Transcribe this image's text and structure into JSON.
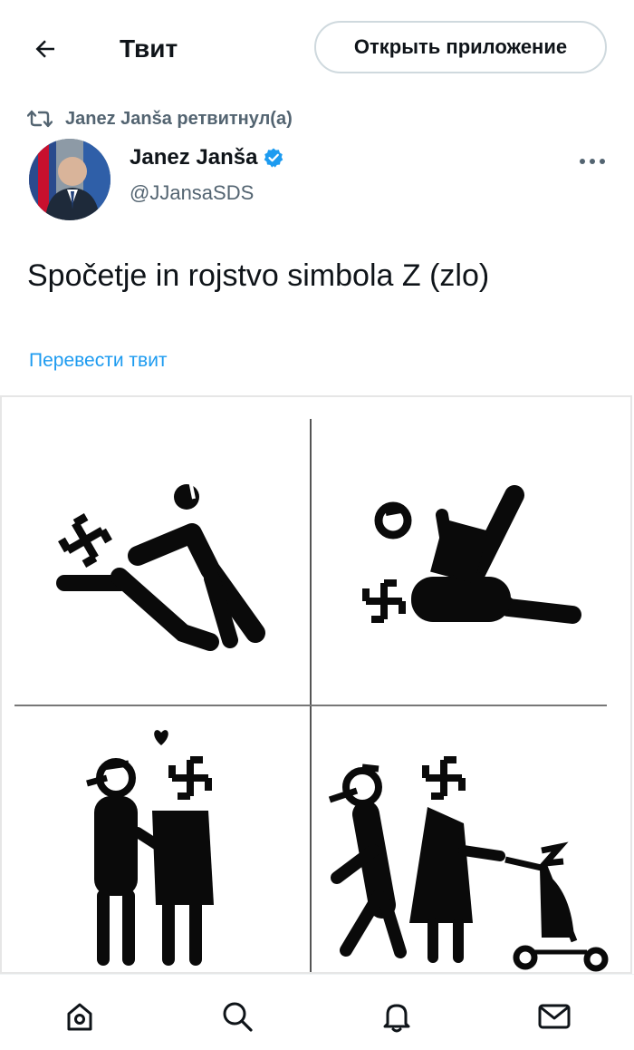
{
  "header": {
    "title": "Твит",
    "open_app_label": "Открыть приложение",
    "back_icon": "arrow-left-icon"
  },
  "tweet": {
    "retweet_text": "Janez Janša ретвитнул(а)",
    "author_name": "Janez Janša",
    "author_handle": "@JJansaSDS",
    "verified": true,
    "text": "Spočetje in rojstvo simbola Z (zlo)",
    "translate_label": "Перевести твит"
  },
  "nav": {
    "items": [
      "home-icon",
      "search-icon",
      "notifications-icon",
      "messages-icon"
    ]
  },
  "colors": {
    "accent": "#1d9bf0",
    "secondary_text": "#536471",
    "primary_text": "#0f1419",
    "border": "#cfd9de"
  }
}
